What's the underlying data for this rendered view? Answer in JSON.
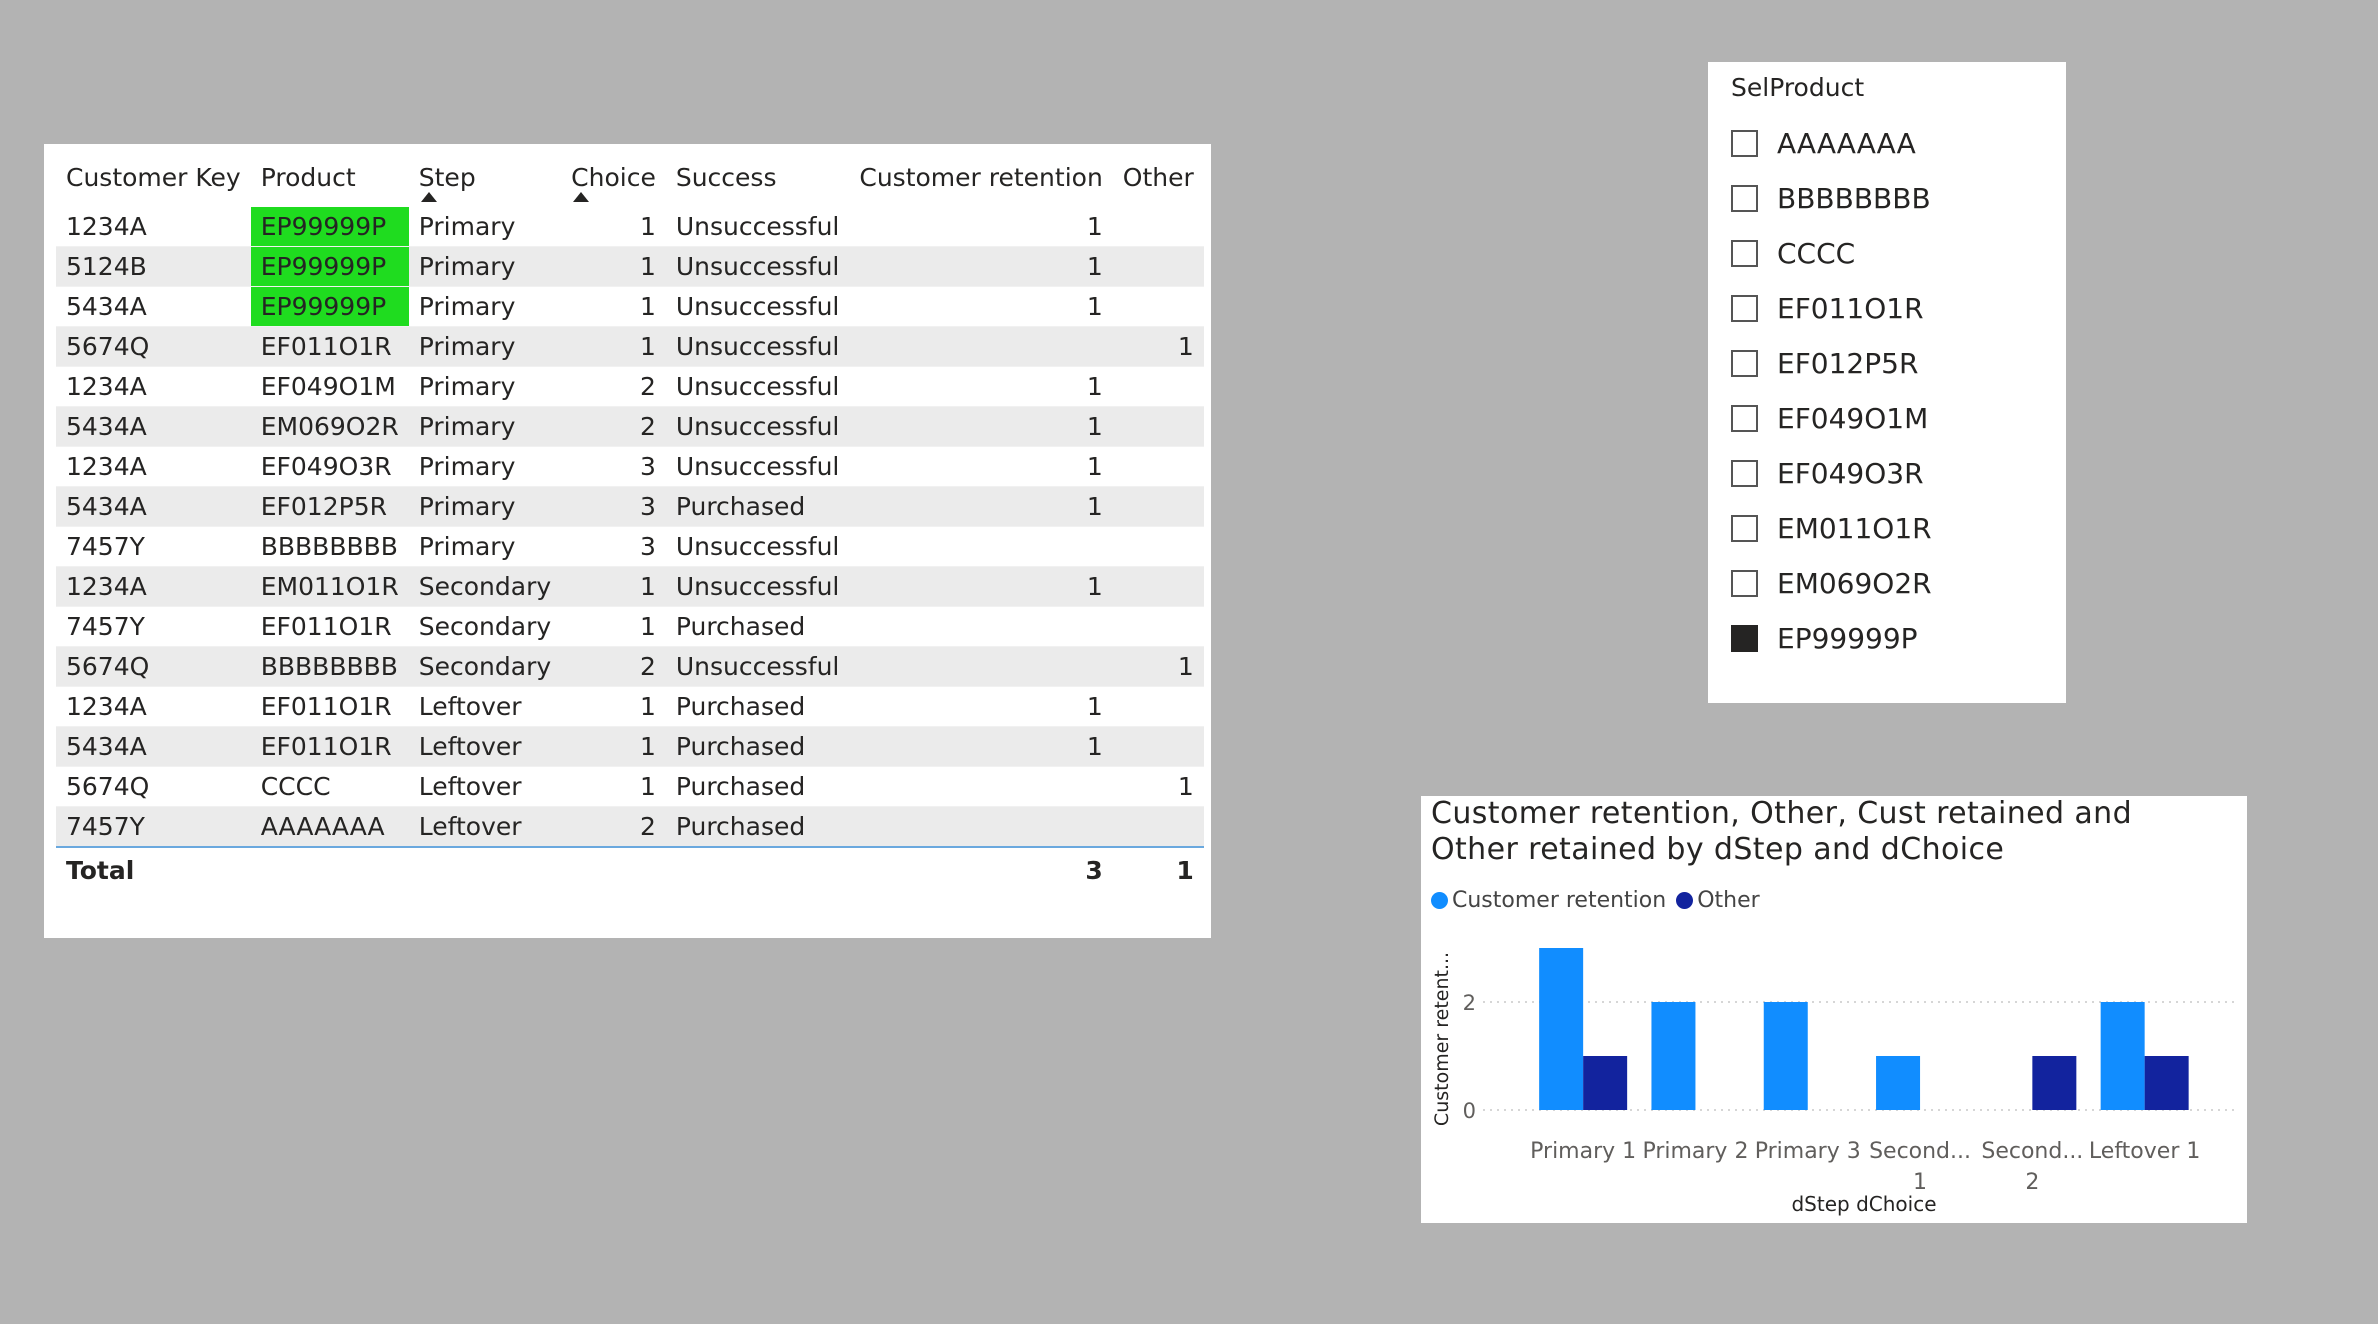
{
  "table": {
    "columns": [
      "Customer Key",
      "Product",
      "Step",
      "Choice",
      "Success",
      "Customer retention",
      "Other"
    ],
    "rows": [
      [
        "1234A",
        "EP99999P",
        "Primary",
        "1",
        "Unsuccessful",
        "1",
        ""
      ],
      [
        "5124B",
        "EP99999P",
        "Primary",
        "1",
        "Unsuccessful",
        "1",
        ""
      ],
      [
        "5434A",
        "EP99999P",
        "Primary",
        "1",
        "Unsuccessful",
        "1",
        ""
      ],
      [
        "5674Q",
        "EF011O1R",
        "Primary",
        "1",
        "Unsuccessful",
        "",
        "1"
      ],
      [
        "1234A",
        "EF049O1M",
        "Primary",
        "2",
        "Unsuccessful",
        "1",
        ""
      ],
      [
        "5434A",
        "EM069O2R",
        "Primary",
        "2",
        "Unsuccessful",
        "1",
        ""
      ],
      [
        "1234A",
        "EF049O3R",
        "Primary",
        "3",
        "Unsuccessful",
        "1",
        ""
      ],
      [
        "5434A",
        "EF012P5R",
        "Primary",
        "3",
        "Purchased",
        "1",
        ""
      ],
      [
        "7457Y",
        "BBBBBBBB",
        "Primary",
        "3",
        "Unsuccessful",
        "",
        ""
      ],
      [
        "1234A",
        "EM011O1R",
        "Secondary",
        "1",
        "Unsuccessful",
        "1",
        ""
      ],
      [
        "7457Y",
        "EF011O1R",
        "Secondary",
        "1",
        "Purchased",
        "",
        ""
      ],
      [
        "5674Q",
        "BBBBBBBB",
        "Secondary",
        "2",
        "Unsuccessful",
        "",
        "1"
      ],
      [
        "1234A",
        "EF011O1R",
        "Leftover",
        "1",
        "Purchased",
        "1",
        ""
      ],
      [
        "5434A",
        "EF011O1R",
        "Leftover",
        "1",
        "Purchased",
        "1",
        ""
      ],
      [
        "5674Q",
        "CCCC",
        "Leftover",
        "1",
        "Purchased",
        "",
        "1"
      ],
      [
        "7457Y",
        "AAAAAAA",
        "Leftover",
        "2",
        "Purchased",
        "",
        ""
      ]
    ],
    "highlight_product": "EP99999P",
    "highlight_color": "#1fdc1f",
    "total": {
      "label": "Total",
      "customer_retention": "3",
      "other": "1"
    }
  },
  "slicer": {
    "title": "SelProduct",
    "items": [
      {
        "label": "AAAAAAA",
        "checked": false
      },
      {
        "label": "BBBBBBBB",
        "checked": false
      },
      {
        "label": "CCCC",
        "checked": false
      },
      {
        "label": "EF011O1R",
        "checked": false
      },
      {
        "label": "EF012P5R",
        "checked": false
      },
      {
        "label": "EF049O1M",
        "checked": false
      },
      {
        "label": "EF049O3R",
        "checked": false
      },
      {
        "label": "EM011O1R",
        "checked": false
      },
      {
        "label": "EM069O2R",
        "checked": false
      },
      {
        "label": "EP99999P",
        "checked": true
      }
    ]
  },
  "chart_data": {
    "type": "bar",
    "title": "Customer retention, Other, Cust retained and Other retained by dStep and dChoice",
    "xlabel": "dStep dChoice",
    "ylabel": "Customer retent...",
    "categories": [
      "Primary 1",
      "Primary 2",
      "Primary 3",
      "Second... 1",
      "Second... 2",
      "Leftover 1"
    ],
    "series": [
      {
        "name": "Customer retention",
        "color": "#118dff",
        "values": [
          3,
          2,
          2,
          1,
          0,
          2
        ]
      },
      {
        "name": "Other",
        "color": "#12239e",
        "values": [
          1,
          0,
          0,
          0,
          1,
          1
        ]
      }
    ],
    "ylim": [
      0,
      3
    ],
    "yticks": [
      0,
      2
    ],
    "grid": true,
    "legend_position": "top-left"
  }
}
